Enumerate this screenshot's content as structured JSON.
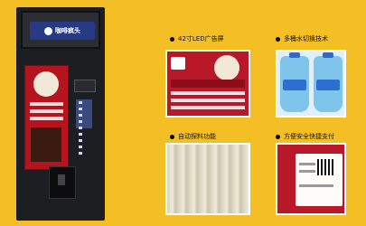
{
  "brand": {
    "logo_text": "咖啡疯头"
  },
  "features": [
    {
      "label": "42寸LED广告屏",
      "image": "led-ad-screen"
    },
    {
      "label": "多桶水切换技术",
      "image": "water-barrels"
    },
    {
      "label": "自动探料功能",
      "image": "curtain-inside"
    },
    {
      "label": "方便安全快捷支付",
      "image": "payment-panel"
    }
  ],
  "colors": {
    "background": "#f4be25",
    "kiosk_red": "#b5141f",
    "kiosk_body": "#1d1e22",
    "logo_blue": "#263a86"
  }
}
